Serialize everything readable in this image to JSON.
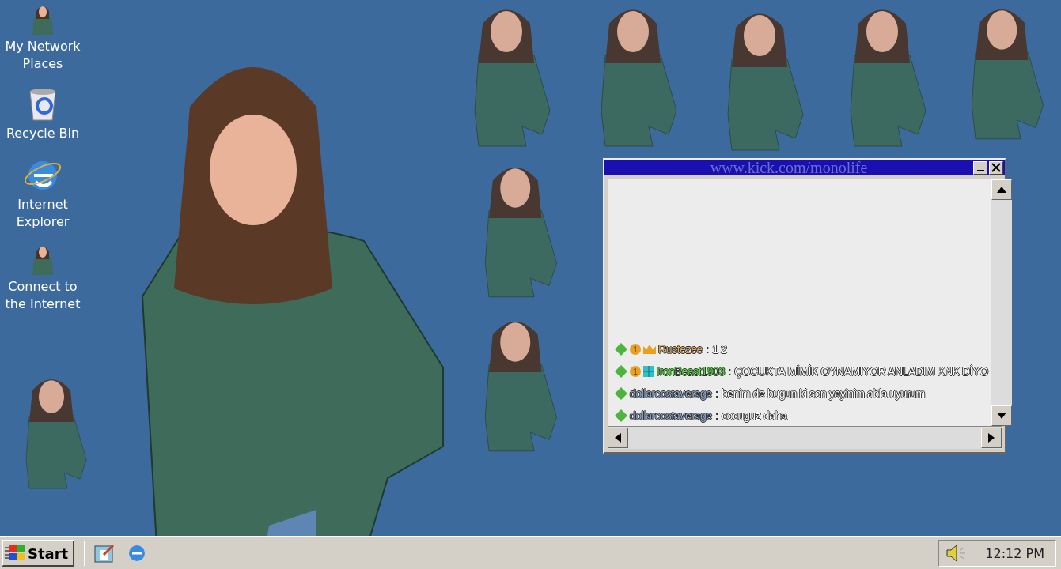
{
  "desktop_icons": [
    {
      "label": "My Network Places",
      "kind": "figure"
    },
    {
      "label": "Recycle Bin",
      "kind": "bin"
    },
    {
      "label": "Internet Explorer",
      "kind": "ie"
    },
    {
      "label": "Connect to the Internet",
      "kind": "figure"
    }
  ],
  "chat_window": {
    "title": "www.kick.com/monolife",
    "messages": [
      {
        "badges": [
          {
            "kind": "diamond"
          },
          {
            "kind": "coin",
            "text": "1"
          },
          {
            "kind": "crown"
          }
        ],
        "user": "Rustezee",
        "color": "#d9a867",
        "separator": ":",
        "text": "1 2"
      },
      {
        "badges": [
          {
            "kind": "diamond"
          },
          {
            "kind": "coin",
            "text": "1"
          },
          {
            "kind": "grid"
          }
        ],
        "user": "IronBeast1903",
        "color": "#4fe03a",
        "separator": ":",
        "text": "ÇOCUKTA MİMİK OYNAMIYOR ANLADIM KNK DİYO"
      },
      {
        "badges": [
          {
            "kind": "diamond"
          }
        ],
        "user": "dollarcostaverage",
        "color": "#8fa6c8",
        "separator": ":",
        "text": "benim de bugun ki son yayinim abla uyurum"
      },
      {
        "badges": [
          {
            "kind": "diamond"
          }
        ],
        "user": "dollarcostaverage",
        "color": "#8fa6c8",
        "separator": ":",
        "text": "cocuguz daha"
      }
    ]
  },
  "taskbar": {
    "start": "Start",
    "quick_launch": [
      {
        "kind": "notepad"
      },
      {
        "kind": "ie"
      }
    ],
    "clock": "12:12 PM"
  }
}
